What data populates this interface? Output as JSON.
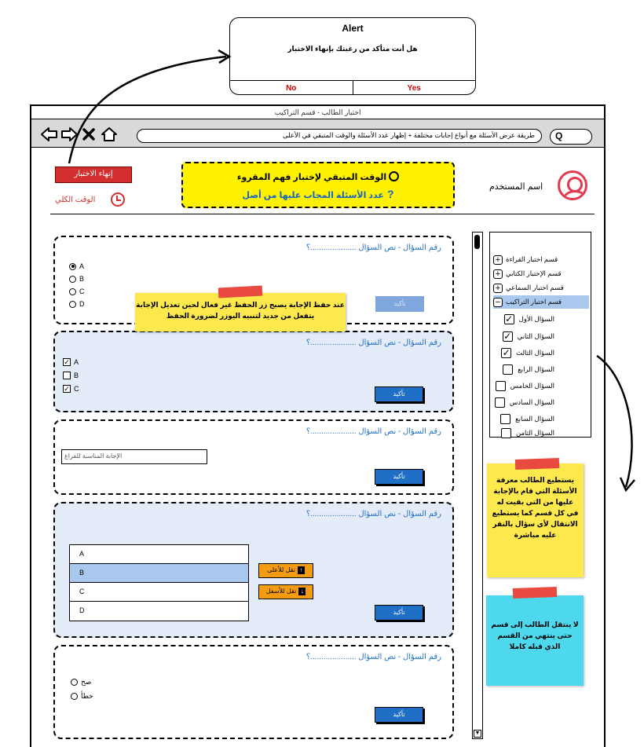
{
  "alert": {
    "title": "Alert",
    "message": "هل أنت متأكد من رغبتك بإنهاء الاختبار",
    "no_label": "No",
    "yes_label": "Yes"
  },
  "window": {
    "title": "اختبار الطالب - قسم التراكيب",
    "address": "طريقة عرض الأسئلة مع أنواع إجابات مختلفة + إظهار عدد الأسئلة والوقت المتبقي في الأعلى",
    "search_glyph": "Q"
  },
  "header": {
    "end_exam_label": "إنهاء الاختبار",
    "total_time_label": "الوقت الكلي",
    "remaining_time_text": "الوقت المتبقي لإختبار فهم المقروء",
    "answered_count_text": "عدد الأسئلة المجاب عليها من أصل",
    "help_glyph": "?",
    "user_name": "اسم المستخدم"
  },
  "questions": [
    {
      "title": "رقم السؤال - نص السؤال .....................؟",
      "type": "radio",
      "options": [
        {
          "label": "A",
          "checked": true
        },
        {
          "label": "B",
          "checked": false
        },
        {
          "label": "C",
          "checked": false
        },
        {
          "label": "D",
          "checked": false
        }
      ],
      "confirm_label": "تأكيد",
      "confirm_enabled": false
    },
    {
      "title": "رقم السؤال - نص السؤال .....................؟",
      "type": "checkbox",
      "options": [
        {
          "label": "A",
          "checked": true
        },
        {
          "label": "B",
          "checked": false
        },
        {
          "label": "C",
          "checked": true
        }
      ],
      "confirm_label": "تأكيد",
      "confirm_enabled": true
    },
    {
      "title": "رقم السؤال - نص السؤال .....................؟",
      "type": "text",
      "placeholder": "الإجابة المناسبة للفراغ",
      "confirm_label": "تأكيد",
      "confirm_enabled": true
    },
    {
      "title": "رقم السؤال - نص السؤال .....................؟",
      "type": "ordering",
      "items": [
        "A",
        "B",
        "C",
        "D"
      ],
      "selected_index": 1,
      "move_up_label": "نقل للأعلى",
      "move_down_label": "نقل للأسفل",
      "confirm_label": "تأكيد",
      "confirm_enabled": true
    },
    {
      "title": "رقم السؤال - نص السؤال .....................؟",
      "type": "truefalse",
      "options": [
        {
          "label": "صح",
          "checked": false
        },
        {
          "label": "خطأ",
          "checked": false
        }
      ],
      "confirm_label": "تأكيد",
      "confirm_enabled": true
    }
  ],
  "notes": {
    "confirm_note": "عند حفظ الإجابة يصبح زر الحفظ غير فعال لحين تعديل الإجابة يتفعل من جديد لتنبيه اليوزر لضرورة الحفظ",
    "navigation_note": "يستطيع الطالب معرفة الأسئلة التي قام بالإجابة عليها من التي بقيت له في كل قسم كما يستطيع الانتقال لأي سؤال بالنقر عليه مباشرة",
    "section_note": "لا ينتقل الطالب إلى قسم حتى ينتهي من القسم الذي قبله كاملا"
  },
  "sections": [
    {
      "label": "قسم اختبار القراءة",
      "expanded": false
    },
    {
      "label": "قسم الإختبار الكتابي",
      "expanded": false
    },
    {
      "label": "قسم اختبار السماعي",
      "expanded": false
    },
    {
      "label": "قسم اختبار التراكيب",
      "expanded": true
    }
  ],
  "section_questions": [
    {
      "label": "السؤال الأول",
      "answered": true
    },
    {
      "label": "السؤال الثاني",
      "answered": true
    },
    {
      "label": "السؤال الثالث",
      "answered": true
    },
    {
      "label": "السؤال الرابع",
      "answered": false
    },
    {
      "label": "السؤال الخامس",
      "answered": false
    },
    {
      "label": "السؤال السادس",
      "answered": false
    },
    {
      "label": "السؤال السابع",
      "answered": false
    },
    {
      "label": "السؤال الثامن",
      "answered": false
    }
  ],
  "colors": {
    "accent_blue": "#1f6fc7",
    "danger_red": "#d32f2f",
    "highlight_yellow": "#fff200",
    "selected_row": "#a8c8ee",
    "move_orange": "#f39c12",
    "note_cyan": "#4dd8ee"
  },
  "icons": {
    "back": "back-arrow-icon",
    "forward": "forward-arrow-icon",
    "close": "close-icon",
    "home": "home-icon",
    "clock": "clock-icon",
    "help": "question-mark-icon",
    "user": "user-avatar-icon",
    "expand": "plus-box-icon",
    "collapse": "minus-box-icon",
    "check": "checked-box-icon"
  }
}
